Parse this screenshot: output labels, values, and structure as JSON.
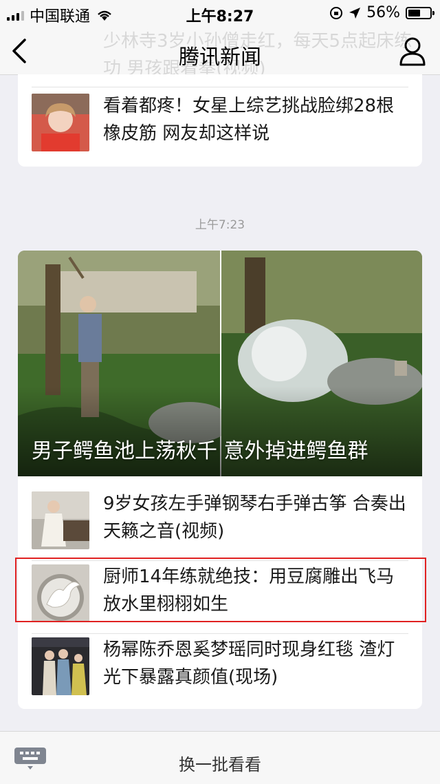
{
  "status_bar": {
    "carrier": "中国联通",
    "time": "上午8:27",
    "battery": "56%",
    "battery_level": 0.56
  },
  "nav": {
    "title": "腾讯新闻",
    "ghost_title": "少林寺3岁小孙僧走红，每天5点起床练功 男孩跟着拳(视频)"
  },
  "card1": {
    "items": [
      {
        "title": "看着都疼！女星上综艺挑战脸绑28根橡皮筋 网友却这样说"
      }
    ]
  },
  "timestamp": "上午7:23",
  "card2": {
    "hero_title": "男子鳄鱼池上荡秋千 意外掉进鳄鱼群",
    "items": [
      {
        "title": "9岁女孩左手弹钢琴右手弹古筝 合奏出天籁之音(视频)"
      },
      {
        "title": "厨师14年练就绝技：用豆腐雕出飞马 放水里栩栩如生"
      },
      {
        "title": "杨幂陈乔恩奚梦瑶同时现身红毯 渣灯光下暴露真颜值(现场)"
      }
    ]
  },
  "bottom": {
    "more_label": "换一批看看"
  },
  "colors": {
    "highlight": "#e02020",
    "background": "#efeff4"
  }
}
